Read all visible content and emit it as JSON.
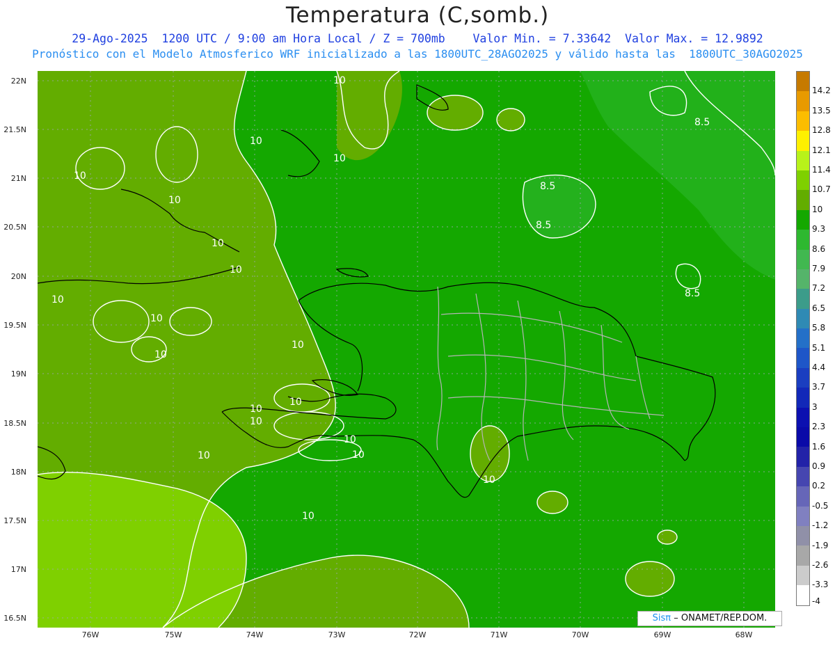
{
  "header": {
    "title": "Temperatura (C,somb.)",
    "subtitle_line1": "29-Ago-2025  1200 UTC / 9:00 am Hora Local / Z = 700mb    Valor Min. = 7.33642  Valor Max. = 12.9892",
    "subtitle_line2": "Pronóstico con el Modelo Atmosferico WRF inicializado a las 1800UTC_28AGO2025 y válido hasta las  1800UTC_30AGO2025"
  },
  "axes": {
    "latitude_labels": [
      "22N",
      "21.5N",
      "21N",
      "20.5N",
      "20N",
      "19.5N",
      "19N",
      "18.5N",
      "18N",
      "17.5N",
      "17N",
      "16.5N"
    ],
    "longitude_labels": [
      "76W",
      "75W",
      "74W",
      "73W",
      "72W",
      "71W",
      "70W",
      "69W",
      "68W"
    ]
  },
  "map_labels": {
    "contour_values": [
      "10",
      "10",
      "10",
      "10",
      "10",
      "10",
      "10",
      "10",
      "10",
      "10",
      "10",
      "10",
      "10",
      "10",
      "10",
      "10",
      "10",
      "10",
      "10",
      "8.5",
      "8.5",
      "8.5",
      "8.5"
    ]
  },
  "legend": {
    "values": [
      "14.2",
      "13.5",
      "12.8",
      "12.1",
      "11.4",
      "10.7",
      "10",
      "9.3",
      "8.6",
      "7.9",
      "7.2",
      "6.5",
      "5.8",
      "5.1",
      "4.4",
      "3.7",
      "3",
      "2.3",
      "1.6",
      "0.9",
      "0.2",
      "-0.5",
      "-1.2",
      "-1.9",
      "-2.6",
      "-3.3",
      "-4"
    ],
    "colors": [
      "#c67a00",
      "#e89a00",
      "#fcbd00",
      "#fef000",
      "#b8f21a",
      "#7fd000",
      "#63ad00",
      "#14a800",
      "#2eb830",
      "#41b850",
      "#55b46a",
      "#3c9c8a",
      "#2f8ab4",
      "#2470c8",
      "#1e56c8",
      "#1a3ec0",
      "#1228b8",
      "#0c10b0",
      "#0a0aa8",
      "#2222a8",
      "#4646b0",
      "#6666b8",
      "#8080c0",
      "#9090a8",
      "#a8a8a8",
      "#cccccc",
      "#ffffff"
    ]
  },
  "credit": {
    "brand": "Sisπ",
    "text": "– ONAMET/REP.DOM."
  }
}
